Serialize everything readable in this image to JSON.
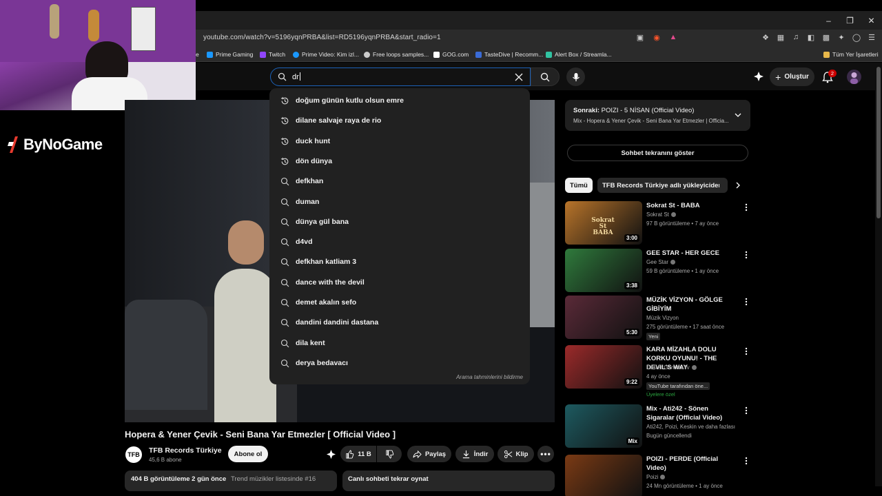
{
  "browser": {
    "url": "youtube.com/watch?v=5196yqnPRBA&list=RD5196yqnPRBA&start_radio=1",
    "bookmarks": [
      {
        "label": "e",
        "color": "#aaaaaa"
      },
      {
        "label": "Prime Gaming",
        "color": "#1a98ff"
      },
      {
        "label": "Twitch",
        "color": "#9146ff"
      },
      {
        "label": "Prime Video: Kim izl...",
        "color": "#1a98ff"
      },
      {
        "label": "Free loops samples...",
        "color": "#cccccc"
      },
      {
        "label": "GOG.com",
        "color": "#ffffff"
      },
      {
        "label": "TasteDive | Recomm...",
        "color": "#3a6bd6"
      },
      {
        "label": "Alert Box / Streamla...",
        "color": "#31c3a2"
      }
    ],
    "all_bookmarks": "Tüm Yer İşaretleri"
  },
  "overlay": {
    "logo_text": "ByNoGame"
  },
  "search": {
    "value": "dr"
  },
  "suggestions": {
    "items": [
      {
        "text": "doğum günün kutlu olsun emre",
        "type": "history"
      },
      {
        "text": "dilane salvaje raya de rio",
        "type": "history"
      },
      {
        "text": "duck hunt",
        "type": "history"
      },
      {
        "text": "dön dünya",
        "type": "history"
      },
      {
        "text": "defkhan",
        "type": "search"
      },
      {
        "text": "duman",
        "type": "search"
      },
      {
        "text": "dünya gül bana",
        "type": "search"
      },
      {
        "text": "d4vd",
        "type": "search"
      },
      {
        "text": "defkhan katliam 3",
        "type": "search"
      },
      {
        "text": "dance with the devil",
        "type": "search"
      },
      {
        "text": "demet akalın sefo",
        "type": "search"
      },
      {
        "text": "dandini dandini dastana",
        "type": "search"
      },
      {
        "text": "dila kent",
        "type": "search"
      },
      {
        "text": "derya bedavacı",
        "type": "search"
      }
    ],
    "report": "Arama tahminlerini bildirme"
  },
  "header": {
    "create_label": "Oluştur",
    "notification_count": "2"
  },
  "video": {
    "title": "Hopera & Yener Çevik - Seni Bana Yar Etmezler [ Official Video ]",
    "channel_logo": "TFB",
    "channel": "TFB Records Türkiye",
    "subscribers": "45,6 B abone",
    "subscribe_label": "Abone ol",
    "likes": "11 B",
    "share_label": "Paylaş",
    "download_label": "İndir",
    "clip_label": "Klip",
    "views_date": "404 B görüntüleme  2 gün önce",
    "trend": "Trend müzikler listesinde #16",
    "chat_replay": "Canlı sohbeti tekrar oynat"
  },
  "playlist": {
    "next_label": "Sonraki:",
    "next_title": "POIZI - 5 NİSAN (Official Video)",
    "subtitle": "Mix - Hopera & Yener Çevik - Seni Bana Yar Etmezler | Officia..."
  },
  "chat_toggle": "Sohbet tekranını göster",
  "chips": [
    "Tümü",
    "TFB Records Türkiye adlı yükleyiciden"
  ],
  "recommendations": [
    {
      "title": "Sokrat St - BABA",
      "channel": "Sokrat St",
      "verified": true,
      "meta": "97 B görüntüleme • 7 ay önce",
      "duration": "3:00",
      "thumb_color": "#b8742a",
      "thumb_text": "Sokrat St BABA"
    },
    {
      "title": "GEE STAR - HER GECE",
      "channel": "Gee Star",
      "verified": true,
      "meta": "59 B görüntüleme • 1 ay önce",
      "duration": "3:38",
      "thumb_color": "#2f7a3c",
      "thumb_text": ""
    },
    {
      "title": "MÜZİK VİZYON - GÖLGE GİBİYİM",
      "channel": "Müzik Vizyon",
      "verified": false,
      "meta": "275 görüntüleme • 17 saat önce",
      "tag": "Yeni",
      "duration": "5:30",
      "thumb_color": "#5a2a38",
      "thumb_text": ""
    },
    {
      "title": "KARA MİZAHLA DOLU KORKU OYUNU! - THE DEVIL'S WAY",
      "channel": "Easter GamersTv",
      "verified": true,
      "meta": "4 ay önce",
      "tag": "YouTube tarafından öne...",
      "member": "Üyelere özel",
      "duration": "9:22",
      "thumb_color": "#9b2a2a",
      "thumb_text": ""
    },
    {
      "title": "Mix - Ati242 - Sönen Sigaralar (Official Video)",
      "channel": "Ati242, Poizi, Keskin ve daha fazlası",
      "verified": false,
      "meta": "Bugün güncellendi",
      "duration": "Mix",
      "thumb_color": "#1d5a60",
      "thumb_text": ""
    },
    {
      "title": "POIZI - PERDE (Official Video)",
      "channel": "Poizi",
      "verified": true,
      "meta": "24 Mn görüntüleme • 1 ay önce",
      "duration": "",
      "thumb_color": "#7a3a14",
      "thumb_text": ""
    }
  ]
}
